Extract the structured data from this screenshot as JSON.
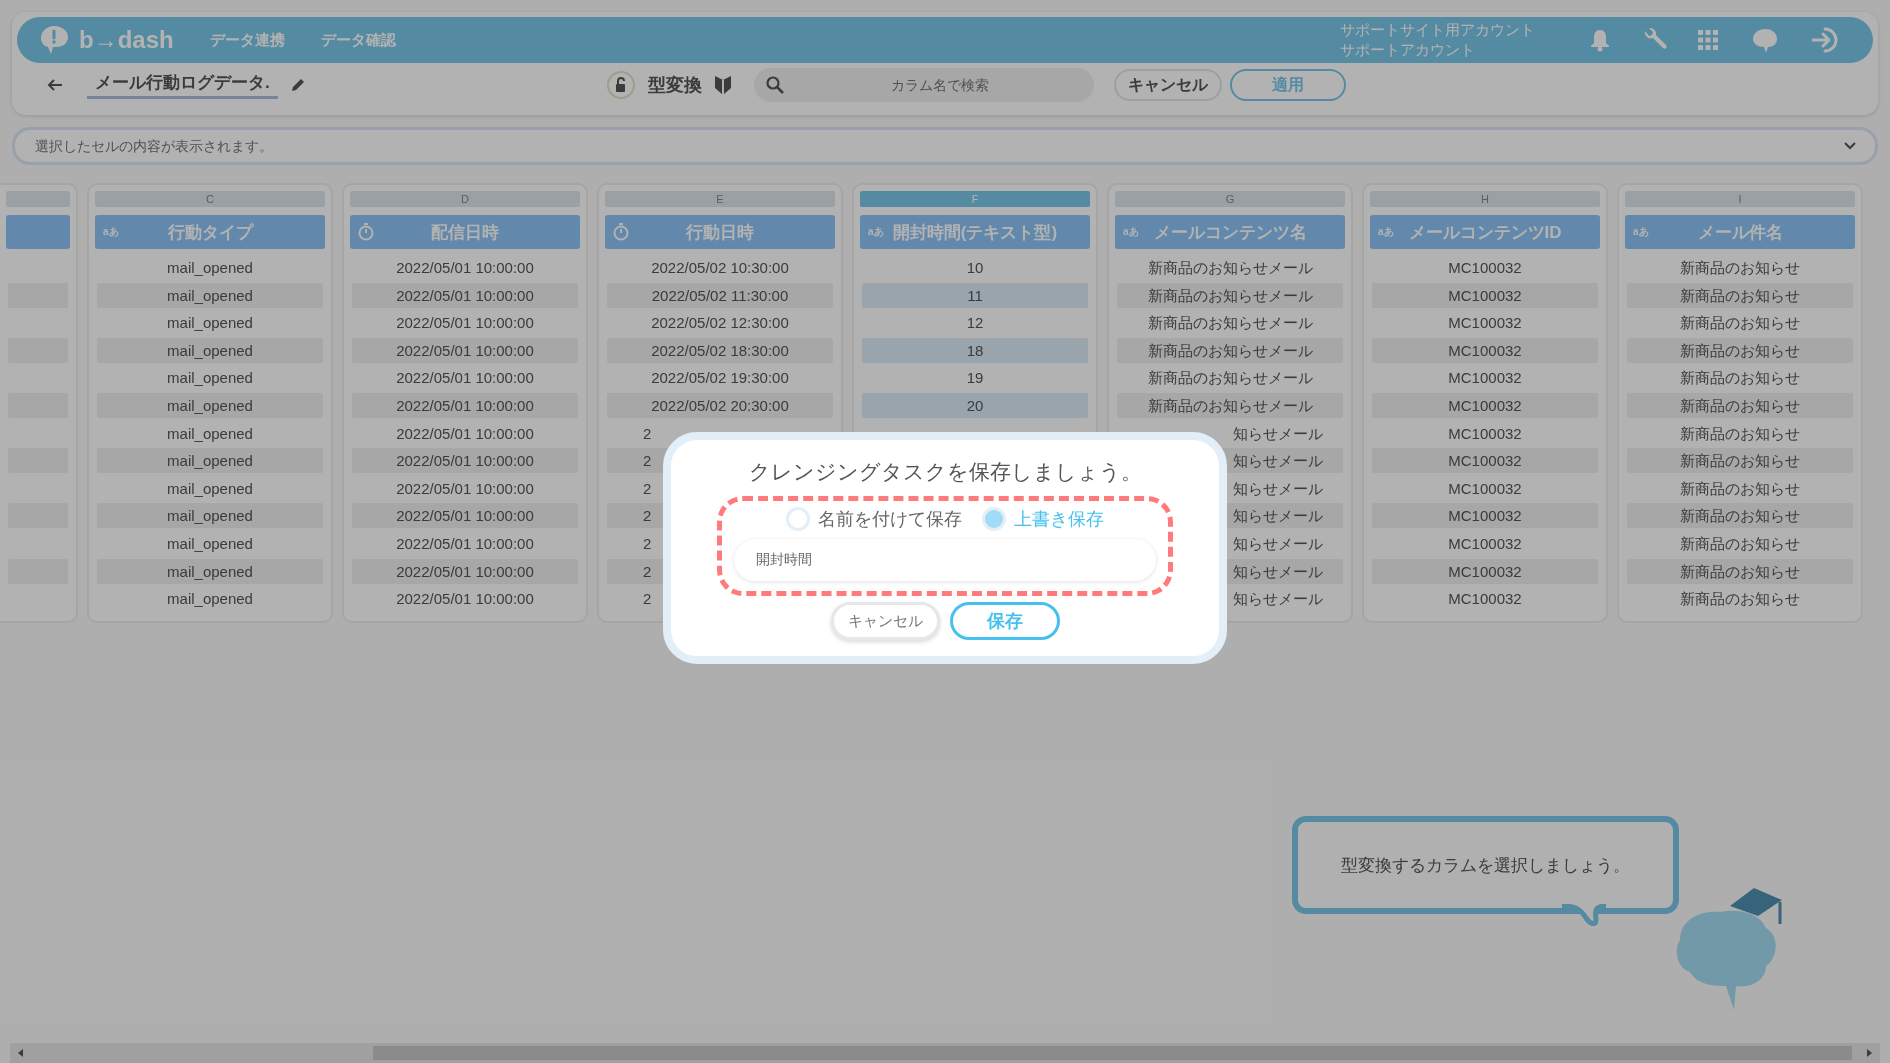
{
  "top_bar": {
    "logo": "b→dash",
    "nav": [
      "データ連携",
      "データ確認"
    ],
    "account": {
      "site": "サポートサイト用アカウント",
      "user": "サポートアカウント"
    }
  },
  "toolbar": {
    "title": "メール行動ログデータ.",
    "mode": "型変換",
    "search": {
      "placeholder": "カラム名で検索"
    },
    "buttons": [
      {
        "label": "キャンセル",
        "primary": false
      },
      {
        "label": "適用",
        "primary": true
      }
    ]
  },
  "cell_bar": {
    "placeholder": "選択したセルの内容が表示されます。"
  },
  "columns": [
    {
      "letter": "C",
      "name": "行動タイプ",
      "kind": "text",
      "type_badge": "aあ",
      "selected": false,
      "cells": [
        "mail_opened",
        "mail_opened",
        "mail_opened",
        "mail_opened",
        "mail_opened",
        "mail_opened",
        "mail_opened",
        "mail_opened",
        "mail_opened",
        "mail_opened",
        "mail_opened",
        "mail_opened",
        "mail_opened"
      ]
    },
    {
      "letter": "D",
      "name": "配信日時",
      "kind": "datetime",
      "selected": false,
      "cells": [
        "2022/05/01 10:00:00",
        "2022/05/01 10:00:00",
        "2022/05/01 10:00:00",
        "2022/05/01 10:00:00",
        "2022/05/01 10:00:00",
        "2022/05/01 10:00:00",
        "2022/05/01 10:00:00",
        "2022/05/01 10:00:00",
        "2022/05/01 10:00:00",
        "2022/05/01 10:00:00",
        "2022/05/01 10:00:00",
        "2022/05/01 10:00:00",
        "2022/05/01 10:00:00"
      ]
    },
    {
      "letter": "E",
      "name": "行動日時",
      "kind": "datetime",
      "selected": false,
      "cells": [
        "2022/05/02 10:30:00",
        "2022/05/02 11:30:00",
        "2022/05/02 12:30:00",
        "2022/05/02 18:30:00",
        "2022/05/02 19:30:00",
        "2022/05/02 20:30:00"
      ],
      "cut_right_cells": [
        "2",
        "2",
        "2",
        "2",
        "2",
        "2",
        "2"
      ]
    },
    {
      "letter": "F",
      "name": "開封時間(テキスト型)",
      "kind": "text",
      "type_badge": "aあ",
      "selected": true,
      "cells": [
        "10",
        "11",
        "12",
        "18",
        "19",
        "20"
      ]
    },
    {
      "letter": "G",
      "name": "メールコンテンツ名",
      "kind": "text",
      "type_badge": "aあ",
      "selected": false,
      "cells": [
        "新商品のお知らせメール",
        "新商品のお知らせメール",
        "新商品のお知らせメール",
        "新商品のお知らせメール",
        "新商品のお知らせメール",
        "新商品のお知らせメール"
      ],
      "cut_left_cells": [
        "知らせメール",
        "知らせメール",
        "知らせメール",
        "知らせメール",
        "知らせメール",
        "知らせメール",
        "知らせメール"
      ]
    },
    {
      "letter": "H",
      "name": "メールコンテンツID",
      "kind": "text",
      "type_badge": "aあ",
      "selected": false,
      "cells": [
        "MC100032",
        "MC100032",
        "MC100032",
        "MC100032",
        "MC100032",
        "MC100032",
        "MC100032",
        "MC100032",
        "MC100032",
        "MC100032",
        "MC100032",
        "MC100032",
        "MC100032"
      ]
    },
    {
      "letter": "I",
      "name": "メール件名",
      "kind": "text",
      "type_badge": "aあ",
      "selected": false,
      "cells": [
        "新商品のお知らせ",
        "新商品のお知らせ",
        "新商品のお知らせ",
        "新商品のお知らせ",
        "新商品のお知らせ",
        "新商品のお知らせ",
        "新商品のお知らせ",
        "新商品のお知らせ",
        "新商品のお知らせ",
        "新商品のお知らせ",
        "新商品のお知らせ",
        "新商品のお知らせ",
        "新商品のお知らせ"
      ]
    }
  ],
  "hint": {
    "text": "型変換するカラムを選択しましょう。"
  },
  "modal": {
    "title": "クレンジングタスクを保存しましょう。",
    "options": [
      {
        "label": "名前を付けて保存",
        "selected": false
      },
      {
        "label": "上書き保存",
        "selected": true
      }
    ],
    "name_value": "開封時間",
    "buttons": [
      {
        "label": "キャンセル",
        "primary": false
      },
      {
        "label": "保存",
        "primary": true
      }
    ]
  }
}
